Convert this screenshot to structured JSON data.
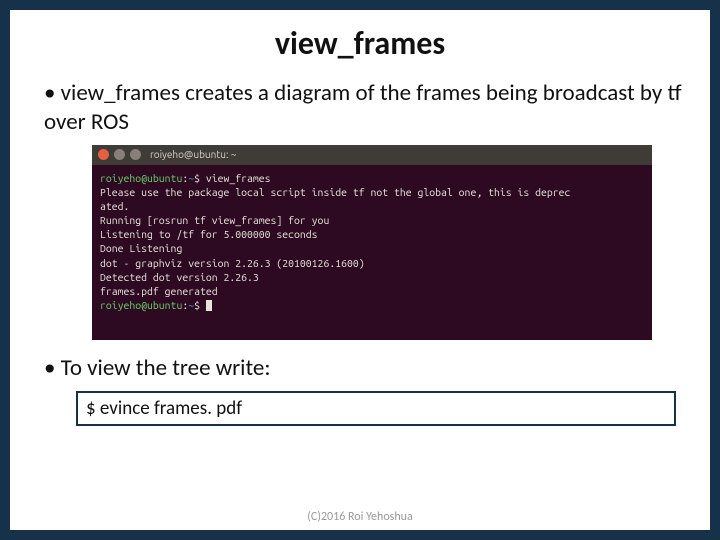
{
  "title": "view_frames",
  "bullet1": "view_frames creates a diagram of the frames being broadcast by tf over ROS",
  "bullet2": "To view the tree write:",
  "codebox": "$ evince frames. pdf",
  "footer": "(C)2016 Roi Yehoshua",
  "terminal": {
    "window_title": "roiyeho@ubuntu: ~",
    "prompt_user": "roiyeho@ubuntu",
    "prompt_path": "~",
    "cmd": "view_frames",
    "lines": [
      "Please use the package local script inside tf not the global one, this is deprec",
      "ated.",
      "Running [rosrun tf view_frames] for you",
      "Listening to /tf for 5.000000 seconds",
      "Done Listening",
      "dot - graphviz version 2.26.3 (20100126.1600)",
      "",
      "Detected dot version 2.26.3",
      "frames.pdf generated"
    ]
  }
}
